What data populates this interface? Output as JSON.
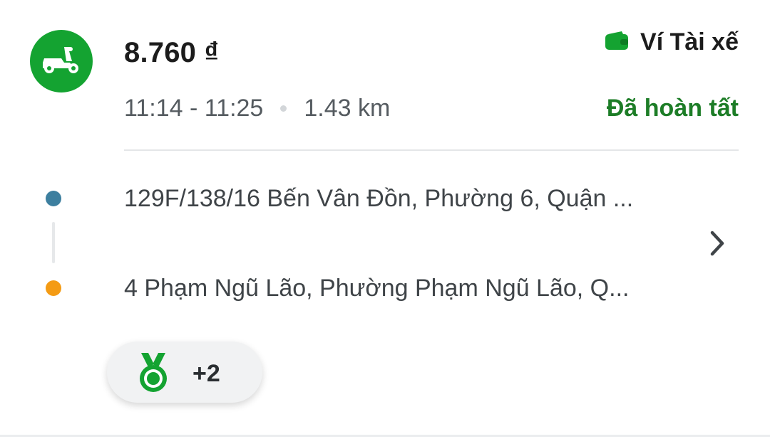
{
  "trip": {
    "fare": "8.760 ₫",
    "payment_method": "Ví Tài xế",
    "time_range": "11:14 - 11:25",
    "distance": "1.43 km",
    "status": "Đã hoàn tất",
    "pickup_address": "129F/138/16 Bến Vân Đồn, Phường 6, Quận ...",
    "dropoff_address": "4 Phạm Ngũ Lão, Phường Phạm Ngũ Lão, Q...",
    "badge_count": "+2"
  },
  "icons": {
    "vehicle": "scooter-icon",
    "payment": "wallet-icon",
    "pickup": "pickup-dot-icon",
    "dropoff": "dropoff-dot-icon",
    "details": "chevron-right-icon",
    "badge": "medal-icon"
  },
  "colors": {
    "brand_green": "#14a331",
    "status_green": "#1d7d27",
    "pickup_dot": "#3d7f9f",
    "dropoff_dot": "#f49b14"
  }
}
